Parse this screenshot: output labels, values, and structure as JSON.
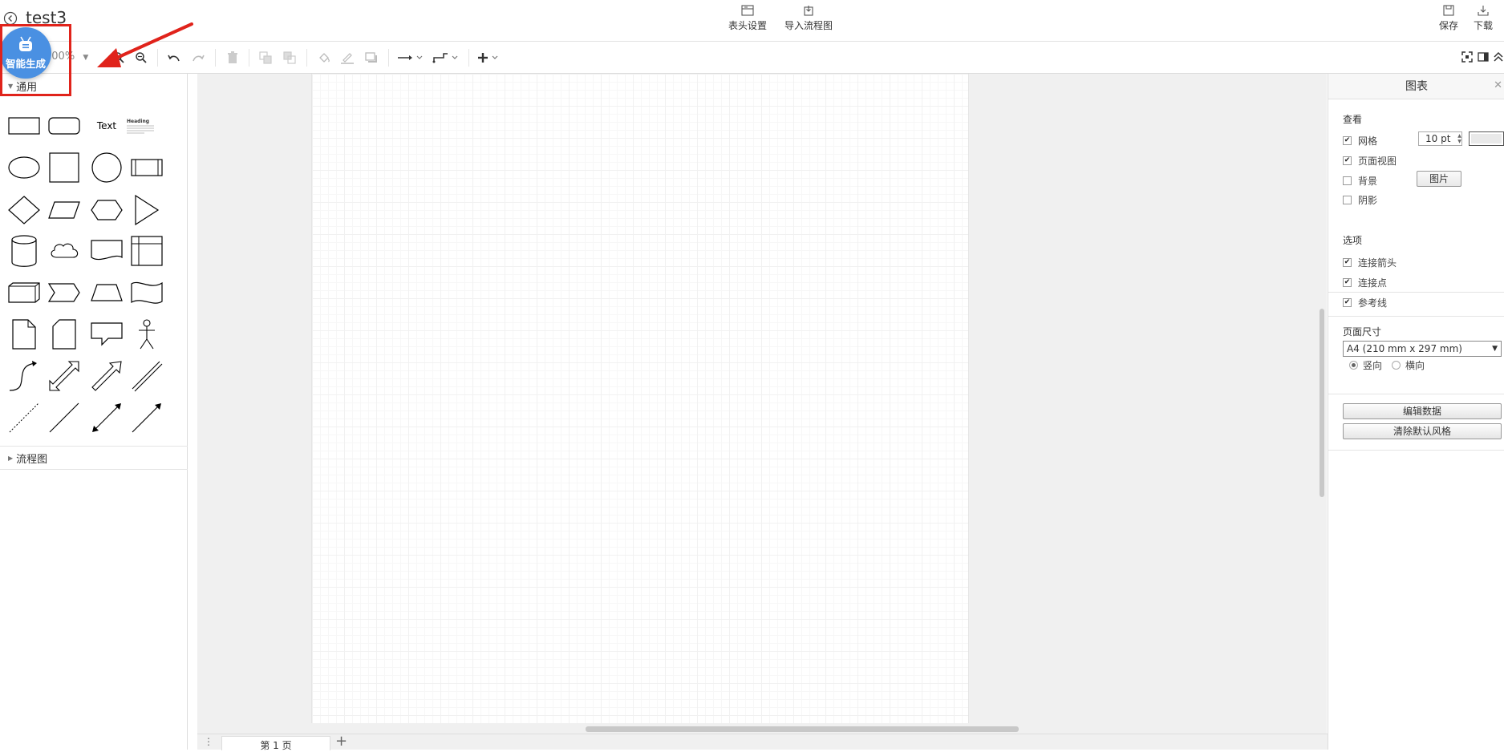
{
  "header": {
    "title": "test3",
    "buttons": {
      "header_settings": "表头设置",
      "import_flowchart": "导入流程图",
      "save": "保存",
      "download": "下载"
    }
  },
  "toolbar": {
    "zoom": "100%",
    "tools": [
      "zoom-in-icon",
      "zoom-out-icon",
      "undo-icon",
      "redo-icon",
      "delete-icon",
      "to-front-icon",
      "to-back-icon",
      "fill-color-icon",
      "line-color-icon",
      "shadow-icon",
      "connection-icon",
      "waypoints-icon",
      "insert-icon",
      "fullscreen-icon",
      "format-panel-icon",
      "collapse-icon"
    ]
  },
  "overlay": {
    "smart_generate": "智能生成",
    "highlight_color": "#e0231b"
  },
  "sidebar": {
    "sections": {
      "general": "通用",
      "flowchart": "流程图"
    },
    "text_shape": "Text",
    "heading_shape": "Heading"
  },
  "tabs": {
    "page1": "第 1 页"
  },
  "format_panel": {
    "title": "图表",
    "view": {
      "title": "查看",
      "grid": {
        "label": "网格",
        "checked": true,
        "size": "10 pt"
      },
      "page_view": {
        "label": "页面视图",
        "checked": true
      },
      "background": {
        "label": "背景",
        "checked": false,
        "button": "图片"
      },
      "shadow": {
        "label": "阴影",
        "checked": false
      }
    },
    "options": {
      "title": "选项",
      "connection_arrows": {
        "label": "连接箭头",
        "checked": true
      },
      "connection_points": {
        "label": "连接点",
        "checked": true
      },
      "guides": {
        "label": "参考线",
        "checked": true
      }
    },
    "page_size": {
      "title": "页面尺寸",
      "selected": "A4 (210 mm x 297 mm)",
      "portrait": "竖向",
      "landscape": "横向"
    },
    "buttons": {
      "edit_data": "编辑数据",
      "clear_default_style": "清除默认风格"
    }
  },
  "colors": {
    "accent_blue": "#4a90e2",
    "annotation_red": "#e0231b"
  }
}
